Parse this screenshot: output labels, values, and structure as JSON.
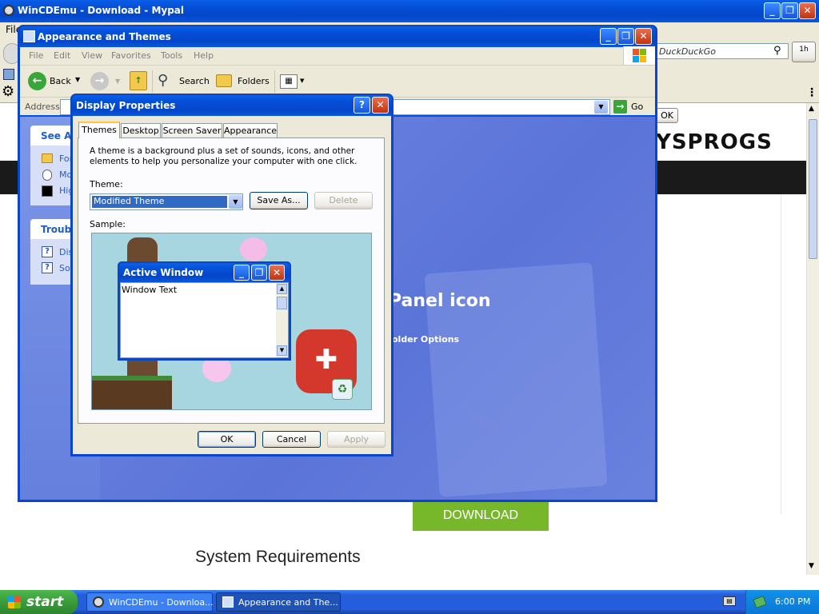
{
  "browser": {
    "title": "WinCDEmu - Download - Mypal",
    "menu_file": "File",
    "search_placeholder": "DuckDuckGo",
    "ok_label": "OK",
    "logo_text": "YSPROGS",
    "panel_heading": "Panel icon",
    "folder_options": "older Options",
    "download_label": "DOWNLOAD",
    "sysreq_heading": "System Requirements",
    "btn_1h": "1h",
    "accent": "#77b82a"
  },
  "explorer": {
    "title": "Appearance and Themes",
    "menu": [
      "File",
      "Edit",
      "View",
      "Favorites",
      "Tools",
      "Help"
    ],
    "toolbar": {
      "back": "Back",
      "search": "Search",
      "folders": "Folders"
    },
    "address_label": "Address",
    "go_label": "Go",
    "see_also_title": "See Als",
    "see_also_items": [
      "For",
      "Mo",
      "Hig"
    ],
    "trouble_title": "Troubl",
    "trouble_items": [
      "Dis",
      "So"
    ]
  },
  "dialog": {
    "title": "Display Properties",
    "help_btn": "?",
    "tabs": [
      "Themes",
      "Desktop",
      "Screen Saver",
      "Appearance"
    ],
    "description": "A theme is a background plus a set of sounds, icons, and other elements to help you personalize your computer with one click.",
    "theme_label": "Theme:",
    "theme_value": "Modified Theme",
    "save_as": "Save As...",
    "delete": "Delete",
    "sample_label": "Sample:",
    "preview_title": "Active Window",
    "preview_text": "Window Text",
    "ok": "OK",
    "cancel": "Cancel",
    "apply": "Apply"
  },
  "taskbar": {
    "start": "start",
    "items": [
      "WinCDEmu - Downloa...",
      "Appearance and The..."
    ],
    "clock": "6:00 PM"
  }
}
